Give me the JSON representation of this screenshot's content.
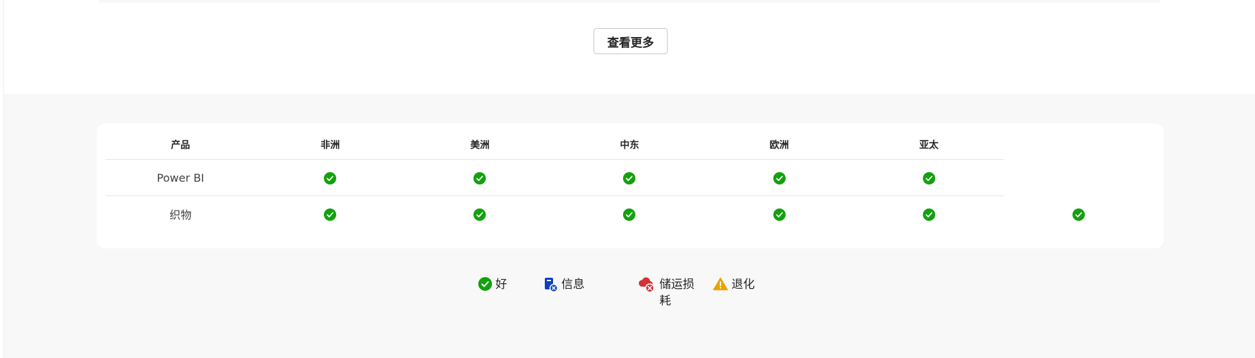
{
  "buttons": {
    "more": "查看更多"
  },
  "table": {
    "headers": [
      "产品",
      "非洲",
      "美洲",
      "中东",
      "欧洲",
      "亚太"
    ],
    "rows": [
      {
        "product": "Power BI",
        "status": [
          "good",
          "good",
          "good",
          "good",
          "good"
        ]
      },
      {
        "product": "织物",
        "status": [
          "good",
          "good",
          "good",
          "good",
          "good"
        ]
      }
    ]
  },
  "legend": {
    "good": "好",
    "info": "信息",
    "degraded_storage": "储运损耗",
    "degraded": "退化"
  },
  "colors": {
    "good": "#13a10e",
    "info": "#0f3ebf",
    "error": "#d13438",
    "warning": "#eaa300"
  }
}
